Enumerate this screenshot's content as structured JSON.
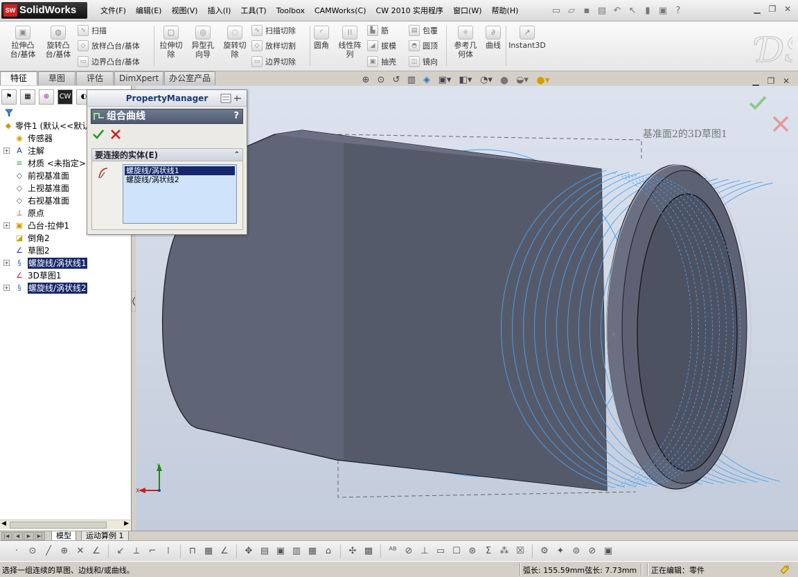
{
  "app": {
    "name": "SolidWorks",
    "logo_badge": "SW"
  },
  "menu": [
    "文件(F)",
    "编辑(E)",
    "视图(V)",
    "插入(I)",
    "工具(T)",
    "Toolbox",
    "CAMWorks(C)",
    "CW 2010 实用程序",
    "窗口(W)",
    "帮助(H)"
  ],
  "command_manager": {
    "extrude_boss": "拉伸凸\n台/基体",
    "revolve_boss": "旋转凸\n台/基体",
    "sweep": "扫描",
    "loft": "放样凸台/基体",
    "boundary_boss": "边界凸台/基体",
    "extrude_cut": "拉伸切\n除",
    "hole_wizard": "异型孔\n向导",
    "revolve_cut": "旋转切\n除",
    "sweep_cut": "扫描切除",
    "loft_cut": "放样切割",
    "boundary_cut": "边界切除",
    "fillet": "圆角",
    "linear_pattern": "线性阵\n列",
    "rib": "筋",
    "draft": "拔模",
    "shell": "抽壳",
    "wrap": "包覆",
    "dome": "圆顶",
    "mirror": "镜向",
    "ref_geometry": "参考几\n何体",
    "curves": "曲线",
    "instant3d": "Instant3D"
  },
  "cm_tabs": [
    "特征",
    "草图",
    "评估",
    "DimXpert",
    "办公室产品"
  ],
  "feature_tree": [
    {
      "label": "零件1 (默认<<默认",
      "icon": "part-icon",
      "expand": false,
      "indent": 0,
      "selected": false
    },
    {
      "label": "传感器",
      "icon": "sensor-icon",
      "expand": false,
      "indent": 1,
      "selected": false
    },
    {
      "label": "注解",
      "icon": "annotation-icon",
      "expand": true,
      "indent": 1,
      "selected": false
    },
    {
      "label": "材质 <未指定>",
      "icon": "material-icon",
      "expand": false,
      "indent": 1,
      "selected": false
    },
    {
      "label": "前视基准面",
      "icon": "plane-icon",
      "expand": false,
      "indent": 1,
      "selected": false
    },
    {
      "label": "上视基准面",
      "icon": "plane-icon",
      "expand": false,
      "indent": 1,
      "selected": false
    },
    {
      "label": "右视基准面",
      "icon": "plane-icon",
      "expand": false,
      "indent": 1,
      "selected": false
    },
    {
      "label": "原点",
      "icon": "origin-icon",
      "expand": false,
      "indent": 1,
      "selected": false
    },
    {
      "label": "凸台-拉伸1",
      "icon": "extrude-icon",
      "expand": true,
      "indent": 1,
      "selected": false
    },
    {
      "label": "倒角2",
      "icon": "chamfer-icon",
      "expand": false,
      "indent": 1,
      "selected": false
    },
    {
      "label": "草图2",
      "icon": "sketch-icon",
      "expand": false,
      "indent": 1,
      "selected": false
    },
    {
      "label": "螺旋线/涡状线1",
      "icon": "helix-icon",
      "expand": true,
      "indent": 1,
      "selected": true
    },
    {
      "label": "3D草图1",
      "icon": "sketch3d-icon",
      "expand": false,
      "indent": 1,
      "selected": false
    },
    {
      "label": "螺旋线/涡状线2",
      "icon": "helix-icon",
      "expand": true,
      "indent": 1,
      "selected": true
    }
  ],
  "property_manager": {
    "title": "PropertyManager",
    "feature_name": "组合曲线",
    "help": "?",
    "group_title": "要连接的实体(E)",
    "entities": [
      "螺旋线/涡状线1",
      "螺旋线/涡状线2"
    ]
  },
  "graphics": {
    "sketch_label": "基准面2的3D草图1",
    "triad_x": "X",
    "triad_y": "Y",
    "colors": {
      "body": "#5f6477",
      "body_dark": "#545868",
      "helix": "#4aa3f0",
      "background_top": "#dde3ee",
      "background_bottom": "#c3ccdb"
    }
  },
  "model_tabs": [
    "模型",
    "运动算例 1"
  ],
  "status": {
    "message": "选择一组连续的草图、边线和/或曲线。",
    "arc": "弧长: 155.59mm弦长: 7.73mm",
    "editing": "正在编辑：零件"
  }
}
